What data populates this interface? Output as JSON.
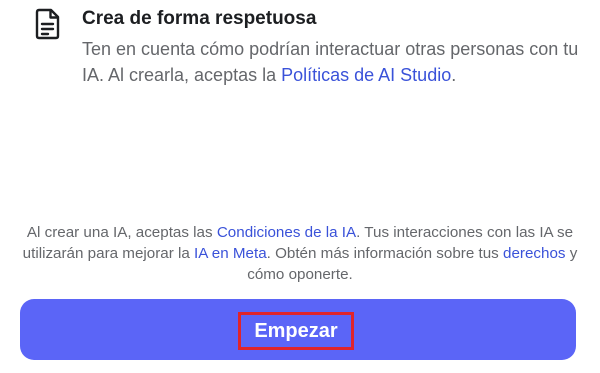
{
  "section": {
    "title": "Crea de forma respetuosa",
    "desc_text": "Ten en cuenta cómo podrían interactuar otras personas con tu IA. Al crearla, aceptas la ",
    "desc_link": "Políticas de AI Studio",
    "desc_end": ".",
    "icon": "document-icon"
  },
  "terms": {
    "part1": "Al crear una IA, aceptas las ",
    "link1": "Condiciones de la IA",
    "part2": ". Tus interacciones con las IA se utilizarán para mejorar la ",
    "link2": "IA en Meta",
    "part3": ". Obtén más información sobre tus ",
    "link3": "derechos",
    "part4": " y cómo oponerte."
  },
  "button": {
    "label": "Empezar"
  },
  "colors": {
    "accent": "#5b65f7",
    "link": "#3a52d9",
    "highlight": "#e0242b"
  }
}
